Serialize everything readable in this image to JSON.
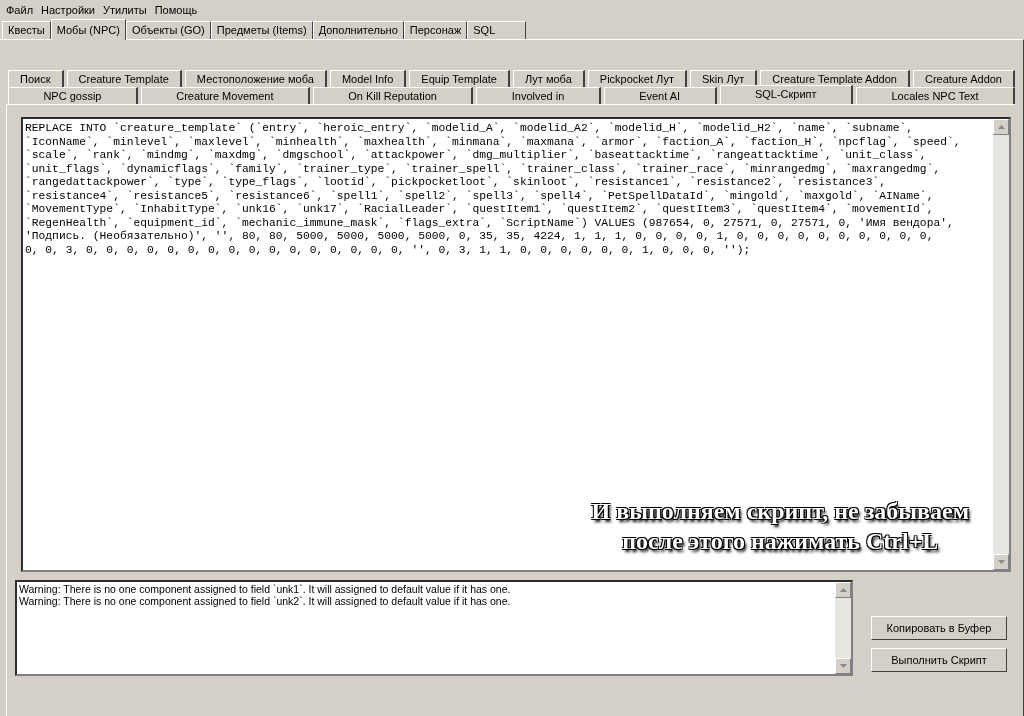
{
  "menu": [
    "Файл",
    "Настройки",
    "Утилиты",
    "Помощь"
  ],
  "main_tabs": [
    {
      "label": "Квесты",
      "selected": false
    },
    {
      "label": "Мобы (NPC)",
      "selected": true
    },
    {
      "label": "Объекты (GO)",
      "selected": false
    },
    {
      "label": "Предметы (Items)",
      "selected": false
    },
    {
      "label": "Дополнительно",
      "selected": false
    },
    {
      "label": "Персонаж",
      "selected": false
    },
    {
      "label": "SQL",
      "selected": false
    }
  ],
  "sub_tab_rows": [
    [
      {
        "label": "Поиск",
        "selected": false
      },
      {
        "label": "Creature Template",
        "selected": false
      },
      {
        "label": "Местоположение моба",
        "selected": false
      },
      {
        "label": "Model Info",
        "selected": false
      },
      {
        "label": "Equip Template",
        "selected": false
      },
      {
        "label": "Лут моба",
        "selected": false
      },
      {
        "label": "Pickpocket Лут",
        "selected": false
      },
      {
        "label": "Skin Лут",
        "selected": false
      },
      {
        "label": "Creature Template Addon",
        "selected": false
      },
      {
        "label": "Creature Addon",
        "selected": false
      }
    ],
    [
      {
        "label": "NPC gossip",
        "selected": false
      },
      {
        "label": "Creature Movement",
        "selected": false
      },
      {
        "label": "On Kill Reputation",
        "selected": false
      },
      {
        "label": "Involved in",
        "selected": false
      },
      {
        "label": "Event AI",
        "selected": false
      },
      {
        "label": "SQL-Скрипт",
        "selected": true
      },
      {
        "label": "Locales NPC Text",
        "selected": false
      }
    ]
  ],
  "script_lines": [
    "REPLACE INTO `creature_template` (`entry`, `heroic_entry`, `modelid_A`, `modelid_A2`, `modelid_H`, `modelid_H2`, `name`, `subname`,",
    "`IconName`, `minlevel`, `maxlevel`, `minhealth`, `maxhealth`, `minmana`, `maxmana`, `armor`, `faction_A`, `faction_H`, `npcflag`, `speed`,",
    "`scale`, `rank`, `mindmg`, `maxdmg`, `dmgschool`, `attackpower`, `dmg_multiplier`, `baseattacktime`, `rangeattacktime`, `unit_class`,",
    "`unit_flags`, `dynamicflags`, `family`, `trainer_type`, `trainer_spell`, `trainer_class`, `trainer_race`, `minrangedmg`, `maxrangedmg`,",
    "`rangedattackpower`, `type`, `type_flags`, `lootid`, `pickpocketloot`, `skinloot`, `resistance1`, `resistance2`, `resistance3`,",
    "`resistance4`, `resistance5`, `resistance6`, `spell1`, `spell2`, `spell3`, `spell4`, `PetSpellDataId`, `mingold`, `maxgold`, `AIName`,",
    "`MovementType`, `InhabitType`, `unk16`, `unk17`, `RacialLeader`, `questItem1`, `questItem2`, `questItem3`, `questItem4`, `movementId`,",
    "`RegenHealth`, `equipment_id`, `mechanic_immune_mask`, `flags_extra`, `ScriptName`) VALUES (987654, 0, 27571, 0, 27571, 0, 'Имя вендора',",
    "'Подпись. (Необязательно)', '', 80, 80, 5000, 5000, 5000, 5000, 0, 35, 35, 4224, 1, 1, 1, 0, 0, 0, 0, 1, 0, 0, 0, 0, 0, 0, 0, 0, 0, 0,",
    "0, 0, 3, 0, 0, 0, 0, 0, 0, 0, 0, 0, 0, 0, 0, 0, 0, 0, 0, '', 0, 3, 1, 1, 0, 0, 0, 0, 0, 0, 1, 0, 0, 0, '');"
  ],
  "caption": [
    "И выполняем скрипт, не забываем",
    "после этого нажимать Ctrl+L"
  ],
  "log_lines": [
    "Warning: There is no one component assigned to field `unk1`. It will assigned to default value if it has one.",
    "Warning: There is no one component assigned to field `unk2`. It will assigned to default value if it has one."
  ],
  "buttons": [
    "Копировать в Буфер",
    "Выполнить Скрипт"
  ]
}
